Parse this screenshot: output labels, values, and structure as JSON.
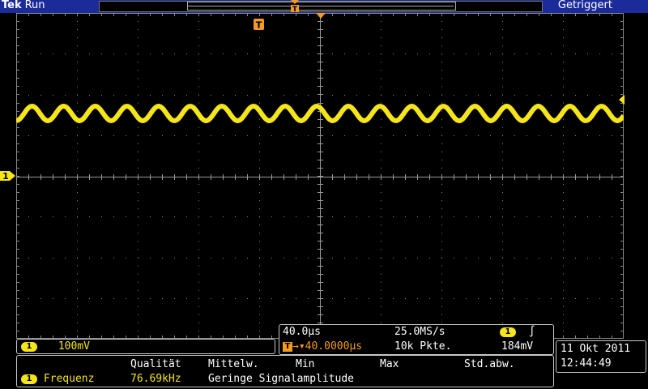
{
  "header": {
    "brand": "Tek",
    "run_state": "Run",
    "trigger_status": "Getriggert"
  },
  "markers": {
    "trigger_position": "T",
    "channel_ground": "1"
  },
  "waveform": {
    "channel": "1",
    "color": "#f5e51a",
    "cycles_on_screen": 19.2
  },
  "channel_panel": {
    "channel": "1",
    "scale": "100mV"
  },
  "timebase": {
    "time_per_div": "40.0µs",
    "sample_rate": "25.0MS/s",
    "trigger_badge": "T",
    "trigger_delay": "40.0000µs",
    "record_length": "10k Pkte.",
    "trigger_channel": "1",
    "trigger_slope": "∫",
    "trigger_level": "184mV"
  },
  "datetime": {
    "date": "11 Okt  2011",
    "time": "12:44:49"
  },
  "measurement": {
    "headers": [
      "Qualität",
      "Mittelw.",
      "Min",
      "Max",
      "Std.abw."
    ],
    "channel": "1",
    "name": "Frequenz",
    "value": "76.69kHz",
    "note": "Geringe Signalamplitude"
  },
  "colors": {
    "accent_blue": "#1b2b9a",
    "channel1": "#f5e51a",
    "trigger": "#f59a23"
  }
}
